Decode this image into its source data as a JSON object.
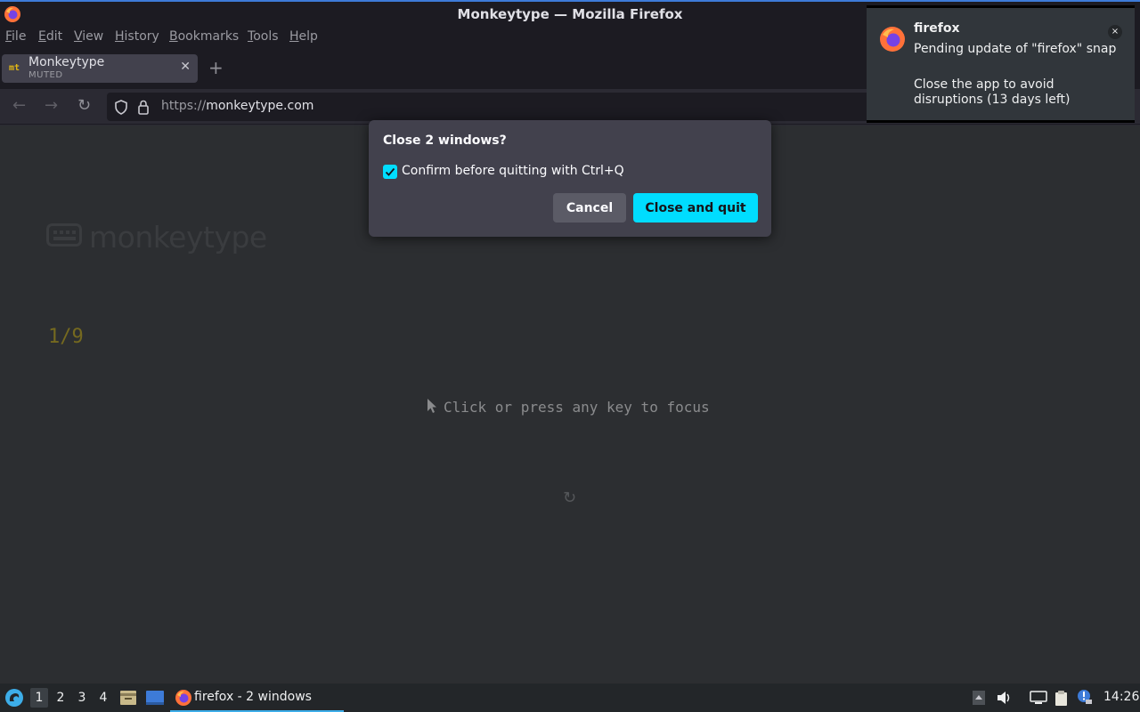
{
  "window": {
    "title": "Monkeytype — Mozilla Firefox"
  },
  "menubar": {
    "items": [
      "File",
      "Edit",
      "View",
      "History",
      "Bookmarks",
      "Tools",
      "Help"
    ]
  },
  "tab": {
    "favicon": "mt",
    "title": "Monkeytype",
    "subtitle": "MUTED",
    "close": "✕",
    "new_tab": "+"
  },
  "navbar": {
    "back": "←",
    "forward": "→",
    "reload": "↻",
    "url_scheme": "https://",
    "url_host": "monkeytype.com"
  },
  "page": {
    "logo_text": "monkeytype",
    "counter": "1/9",
    "focus_message": "Click or press any key to focus",
    "restart_icon": "↻"
  },
  "dialog": {
    "title": "Close 2 windows?",
    "checkbox_label": "Confirm before quitting with Ctrl+Q",
    "checkbox_checked": true,
    "cancel_label": "Cancel",
    "confirm_label": "Close and quit",
    "accent_color": "#00ddff"
  },
  "notification": {
    "app": "firefox",
    "summary": "Pending update of \"firefox\" snap",
    "body": "Close the app to avoid disruptions (13 days left)",
    "close": "×"
  },
  "taskbar": {
    "workspaces": [
      "1",
      "2",
      "3",
      "4"
    ],
    "active_workspace": "1",
    "task_label": "firefox - 2 windows",
    "clock": "14:26"
  }
}
